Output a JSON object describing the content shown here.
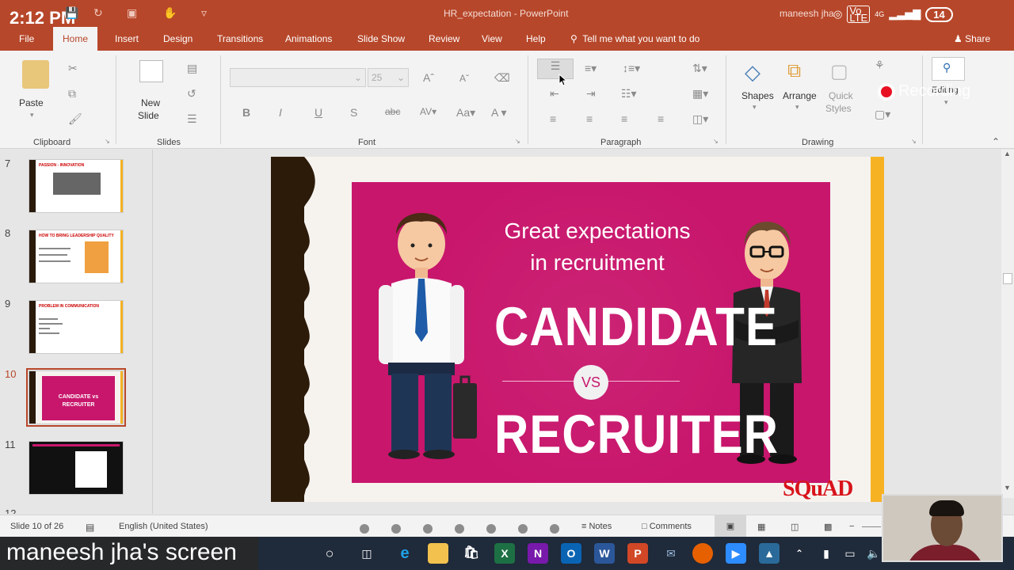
{
  "titlebar": {
    "phone_time": "2:12 PM",
    "document_title": "HR_expectation - PowerPoint",
    "user": "maneesh jha",
    "battery": "14",
    "network": "4G"
  },
  "tabs": [
    "File",
    "Home",
    "Insert",
    "Design",
    "Transitions",
    "Animations",
    "Slide Show",
    "Review",
    "View",
    "Help"
  ],
  "active_tab": "Home",
  "tell_me": "Tell me what you want to do",
  "share": "Share",
  "ribbon": {
    "paste": "Paste",
    "new_slide_line1": "New",
    "new_slide_line2": "Slide",
    "font_size": "25",
    "shapes": "Shapes",
    "arrange": "Arrange",
    "quick_styles_line1": "Quick",
    "quick_styles_line2": "Styles",
    "editing": "Editing",
    "recording": "Recording",
    "groups": {
      "clipboard": "Clipboard",
      "slides": "Slides",
      "font": "Font",
      "paragraph": "Paragraph",
      "drawing": "Drawing"
    }
  },
  "thumbnails": [
    {
      "number": "7",
      "title": "PASSION - INNOVATION"
    },
    {
      "number": "8",
      "title": "HOW TO BRING LEADERSHIP QUALITY"
    },
    {
      "number": "9",
      "title": "PROBLEM IN COMMUNICATION"
    },
    {
      "number": "10",
      "title": "CANDIDATE vs RECRUITER"
    },
    {
      "number": "11",
      "title": ""
    },
    {
      "number": "12",
      "title": ""
    }
  ],
  "selected_slide": "10",
  "slide": {
    "headline_line1": "Great expectations",
    "headline_line2": "in recruitment",
    "word1": "CANDIDATE",
    "vs": "VS",
    "word2": "RECRUITER",
    "logo": "SQuAD"
  },
  "statusbar": {
    "slide_counter": "Slide 10 of 26",
    "language": "English (United States)",
    "notes": "Notes",
    "comments": "Comments"
  },
  "screen_share_label": "maneesh jha's screen",
  "colors": {
    "accent": "#b7472a",
    "slide_magenta": "#c8166c",
    "slide_yellow": "#f7b224",
    "slide_brown": "#2d1b0a"
  }
}
